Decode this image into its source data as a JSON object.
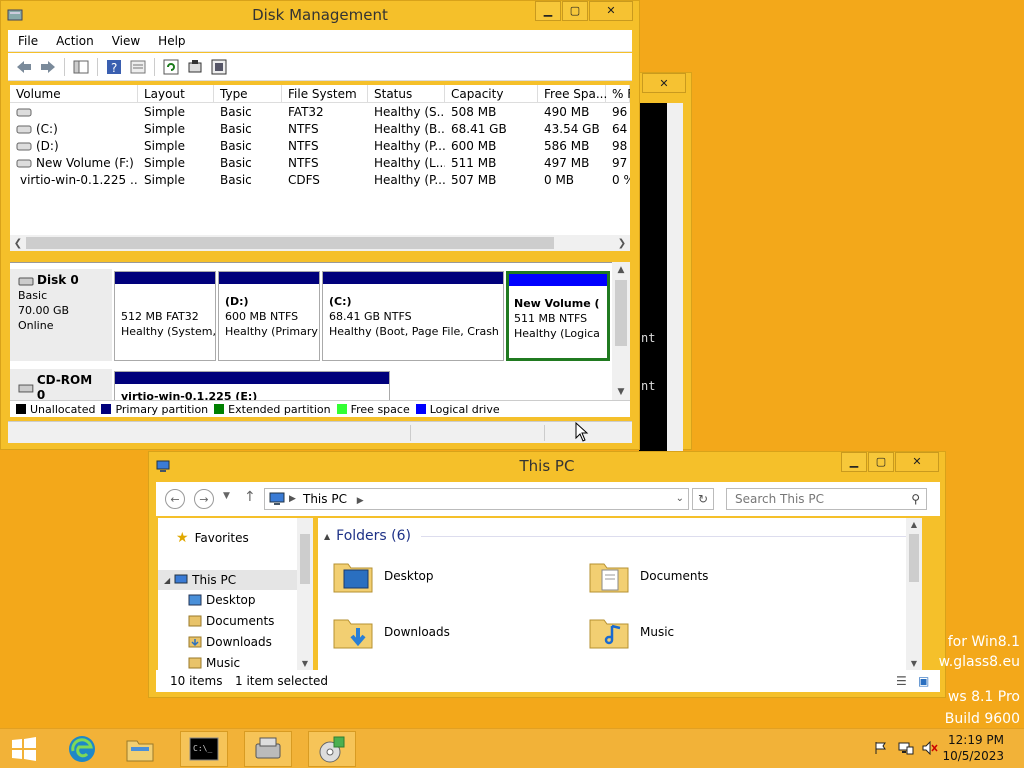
{
  "disk_mgmt": {
    "title": "Disk Management",
    "menu": [
      "File",
      "Action",
      "View",
      "Help"
    ],
    "columns": [
      "Volume",
      "Layout",
      "Type",
      "File System",
      "Status",
      "Capacity",
      "Free Spa...",
      "% F"
    ],
    "rows": [
      [
        "",
        "Simple",
        "Basic",
        "FAT32",
        "Healthy (S...",
        "508 MB",
        "490 MB",
        "96"
      ],
      [
        "(C:)",
        "Simple",
        "Basic",
        "NTFS",
        "Healthy (B...",
        "68.41 GB",
        "43.54 GB",
        "64"
      ],
      [
        "(D:)",
        "Simple",
        "Basic",
        "NTFS",
        "Healthy (P...",
        "600 MB",
        "586 MB",
        "98"
      ],
      [
        "New Volume (F:)",
        "Simple",
        "Basic",
        "NTFS",
        "Healthy (L...",
        "511 MB",
        "497 MB",
        "97"
      ],
      [
        "virtio-win-0.1.225 ...",
        "Simple",
        "Basic",
        "CDFS",
        "Healthy (P...",
        "507 MB",
        "0 MB",
        "0 %"
      ]
    ],
    "disk0": {
      "name": "Disk 0",
      "type": "Basic",
      "size": "70.00 GB",
      "state": "Online"
    },
    "partitions": [
      {
        "name": "",
        "size": "512 MB FAT32",
        "status": "Healthy (System,"
      },
      {
        "name": "(D:)",
        "size": "600 MB NTFS",
        "status": "Healthy (Primary"
      },
      {
        "name": "(C:)",
        "size": "68.41 GB NTFS",
        "status": "Healthy (Boot, Page File, Crash D"
      },
      {
        "name": "New Volume  (",
        "size": "511 MB NTFS",
        "status": "Healthy (Logica"
      }
    ],
    "cdrom": {
      "name": "CD-ROM 0",
      "type": "CD-ROM",
      "partition": "virtio-win-0.1.225  (E:)"
    },
    "legend": [
      {
        "label": "Unallocated",
        "color": "#000000"
      },
      {
        "label": "Primary partition",
        "color": "#00007b"
      },
      {
        "label": "Extended partition",
        "color": "#008000"
      },
      {
        "label": "Free space",
        "color": "#33ff33"
      },
      {
        "label": "Logical drive",
        "color": "#0000ff"
      }
    ]
  },
  "cmd": {
    "line1": "nt",
    "line2": "nt"
  },
  "explorer": {
    "title": "This PC",
    "address": "This PC",
    "search_placeholder": "Search This PC",
    "nav": {
      "favorites": "Favorites",
      "this_pc": "This PC",
      "desktop": "Desktop",
      "documents": "Documents",
      "downloads": "Downloads",
      "music": "Music"
    },
    "group_header": "Folders (6)",
    "folders": [
      "Desktop",
      "Documents",
      "Downloads",
      "Music"
    ],
    "status_items": "10 items",
    "status_selected": "1 item selected"
  },
  "watermark": {
    "line1": "for Win8.1",
    "line2": "w.glass8.eu",
    "line3": "ws 8.1 Pro",
    "line4": "Build 9600"
  },
  "clock": {
    "time": "12:19 PM",
    "date": "10/5/2023"
  },
  "colors": {
    "desktop": "#f3a81a",
    "window_frame": "#f5c02a",
    "primary": "#00007b",
    "logical": "#0000ff",
    "selected_border": "#207a20"
  }
}
